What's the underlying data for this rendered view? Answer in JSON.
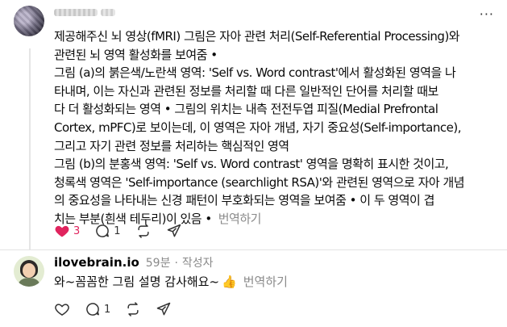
{
  "post": {
    "menu_label": "···",
    "text_lines": [
      "제공해주신 뇌 영상(fMRI) 그림은 자아 관련 처리(Self-Referential Processing)와",
      "관련된 뇌 영역 활성화를 보여줌 •",
      "그림 (a)의 붉은색/노란색 영역: 'Self vs. Word contrast'에서 활성화된 영역을 나",
      "타내며, 이는 자신과 관련된 정보를 처리할 때 다른 일반적인 단어를 처리할 때보",
      "다 더 활성화되는 영역 • 그림의 위치는 내측 전전두엽 피질(Medial Prefrontal",
      "Cortex, mPFC)로 보이는데, 이 영역은 자아 개념, 자기 중요성(Self-importance),",
      "그리고 자기 관련 정보를 처리하는 핵심적인 영역",
      "그림 (b)의 분홍색 영역: 'Self vs. Word contrast' 영역을 명확히 표시한 것이고,",
      "청록색 영역은 'Self-importance (searchlight RSA)'와 관련된 영역으로 자아 개념",
      "의 중요성을 나타내는 신경 패턴이 부호화되는 영역을 보여줌 • 이 두 영역이 겹",
      "치는 부분(흰색 테두리)이 있음 •"
    ],
    "translate_label": "번역하기",
    "like_count": "3",
    "reply_count": "1",
    "colors": {
      "like": "#e0245e"
    }
  },
  "reply": {
    "username": "ilovebrain.io",
    "time": "59분",
    "author_label": "작성자",
    "text": "와~꼼꼼한 그림 설명 감사해요~",
    "emoji": "👍",
    "translate_label": "번역하기",
    "reply_count": "1"
  }
}
